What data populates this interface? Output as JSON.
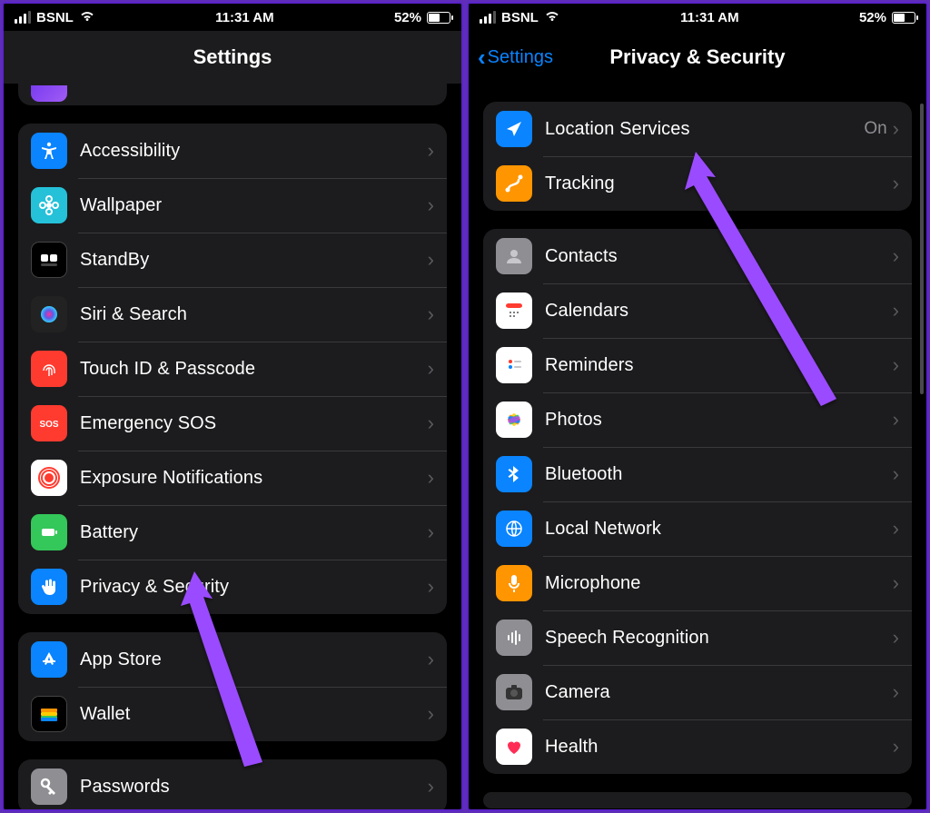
{
  "status": {
    "carrier": "BSNL",
    "time": "11:31 AM",
    "battery_pct": "52%"
  },
  "left": {
    "title": "Settings",
    "groups": [
      {
        "id": "g1",
        "rows": [
          {
            "id": "accessibility",
            "label": "Accessibility",
            "icon": "accessibility",
            "bg": "#0a84ff"
          },
          {
            "id": "wallpaper",
            "label": "Wallpaper",
            "icon": "flower",
            "bg": "#25c1d9"
          },
          {
            "id": "standby",
            "label": "StandBy",
            "icon": "clockwidget",
            "bg": "#000",
            "border": "#444"
          },
          {
            "id": "siri",
            "label": "Siri & Search",
            "icon": "siri",
            "bg": "#222"
          },
          {
            "id": "touchid",
            "label": "Touch ID & Passcode",
            "icon": "fingerprint",
            "bg": "#ff3b30"
          },
          {
            "id": "sos",
            "label": "Emergency SOS",
            "icon": "sos",
            "bg": "#ff3b30"
          },
          {
            "id": "exposure",
            "label": "Exposure Notifications",
            "icon": "exposure",
            "bg": "#fff"
          },
          {
            "id": "battery",
            "label": "Battery",
            "icon": "battery",
            "bg": "#34c759"
          },
          {
            "id": "privacy",
            "label": "Privacy & Security",
            "icon": "hand",
            "bg": "#0a84ff"
          }
        ]
      },
      {
        "id": "g2",
        "rows": [
          {
            "id": "appstore",
            "label": "App Store",
            "icon": "appstore",
            "bg": "#0a84ff"
          },
          {
            "id": "wallet",
            "label": "Wallet",
            "icon": "wallet",
            "bg": "#000",
            "border": "#444"
          }
        ]
      },
      {
        "id": "g3",
        "rows": [
          {
            "id": "passwords",
            "label": "Passwords",
            "icon": "key",
            "bg": "#8e8e93"
          }
        ]
      }
    ]
  },
  "right": {
    "back_label": "Settings",
    "title": "Privacy & Security",
    "groups": [
      {
        "id": "rg1",
        "rows": [
          {
            "id": "location",
            "label": "Location Services",
            "value": "On",
            "icon": "location",
            "bg": "#0a84ff"
          },
          {
            "id": "tracking",
            "label": "Tracking",
            "icon": "tracking",
            "bg": "#ff9500"
          }
        ]
      },
      {
        "id": "rg2",
        "rows": [
          {
            "id": "contacts",
            "label": "Contacts",
            "icon": "contacts",
            "bg": "#8e8e93"
          },
          {
            "id": "calendars",
            "label": "Calendars",
            "icon": "calendar",
            "bg": "#fff"
          },
          {
            "id": "reminders",
            "label": "Reminders",
            "icon": "reminders",
            "bg": "#fff"
          },
          {
            "id": "photos",
            "label": "Photos",
            "icon": "photos",
            "bg": "#fff"
          },
          {
            "id": "bluetooth",
            "label": "Bluetooth",
            "icon": "bluetooth",
            "bg": "#0a84ff"
          },
          {
            "id": "localnet",
            "label": "Local Network",
            "icon": "globe",
            "bg": "#0a84ff"
          },
          {
            "id": "microphone",
            "label": "Microphone",
            "icon": "mic",
            "bg": "#ff9500"
          },
          {
            "id": "speech",
            "label": "Speech Recognition",
            "icon": "speech",
            "bg": "#8e8e93"
          },
          {
            "id": "camera",
            "label": "Camera",
            "icon": "camera",
            "bg": "#8e8e93"
          },
          {
            "id": "health",
            "label": "Health",
            "icon": "health",
            "bg": "#fff"
          }
        ]
      }
    ]
  }
}
